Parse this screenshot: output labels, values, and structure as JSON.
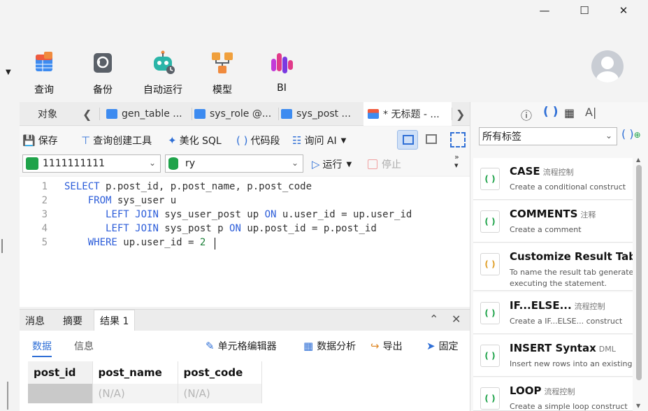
{
  "ribbon": {
    "items": [
      {
        "label": "查询",
        "icon": "query-table-icon"
      },
      {
        "label": "备份",
        "icon": "backup-icon"
      },
      {
        "label": "自动运行",
        "icon": "robot-icon"
      },
      {
        "label": "模型",
        "icon": "model-icon"
      },
      {
        "label": "BI",
        "icon": "bi-chart-icon"
      }
    ]
  },
  "tabs": {
    "objects": "对象",
    "items": [
      "gen_table ...",
      "sys_role @...",
      "sys_post ...",
      "* 无标题 - ..."
    ]
  },
  "toolbar": {
    "save": "保存",
    "query_builder": "查询创建工具",
    "beautify": "美化 SQL",
    "snippet": "代码段",
    "ask_ai": "询问 AI"
  },
  "selectors": {
    "connection": "1111111111",
    "database": "ry",
    "run": "运行",
    "stop": "停止"
  },
  "editor": {
    "line_numbers": [
      "1",
      "2",
      "3",
      "4",
      "5"
    ]
  },
  "results": {
    "tabs": [
      "消息",
      "摘要",
      "结果 1"
    ],
    "subtabs": [
      "数据",
      "信息"
    ],
    "tools": {
      "cell_editor": "单元格编辑器",
      "analysis": "数据分析",
      "export": "导出",
      "pin": "固定"
    },
    "columns": [
      "post_id",
      "post_name",
      "post_code"
    ],
    "rows": [
      [
        "(N/A)",
        "(N/A)",
        "(N/A)"
      ]
    ]
  },
  "side_panel": {
    "icons": [
      "info-icon",
      "code-icon",
      "grid-icon",
      "ai-icon"
    ],
    "tags_filter": "所有标签",
    "snippets": [
      {
        "title": "CASE",
        "category": "流程控制",
        "desc": "Create a conditional construct"
      },
      {
        "title": "COMMENTS",
        "category": "注释",
        "desc": "Create a comment"
      },
      {
        "title": "Customize Result Tab",
        "category": "",
        "desc": "To name the result tab generated",
        "desc2": "executing the statement."
      },
      {
        "title": "IF...ELSE...",
        "category": "流程控制",
        "desc": "Create a IF...ELSE... construct"
      },
      {
        "title": "INSERT Syntax",
        "category": "DML",
        "desc": "Insert new rows into an existing ta"
      },
      {
        "title": "LOOP",
        "category": "流程控制",
        "desc": "Create a simple loop construct"
      }
    ]
  },
  "colors": {
    "accent": "#2f6fd6",
    "keyword": "#2b5cd9"
  }
}
